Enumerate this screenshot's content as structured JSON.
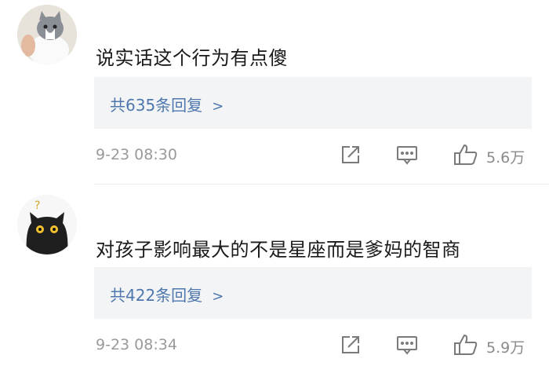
{
  "comments": [
    {
      "avatar_icon": "cat-avatar-icon",
      "text": "说实话这个行为有点傻",
      "reply_label": "共635条回复",
      "timestamp": "9-23 08:30",
      "likes": "5.6万"
    },
    {
      "avatar_icon": "black-cat-avatar-icon",
      "text": "对孩子影响最大的不是星座而是爹妈的智商",
      "reply_label": "共422条回复",
      "timestamp": "9-23 08:34",
      "likes": "5.9万"
    }
  ],
  "colors": {
    "reply_link": "#4e77ad",
    "reply_bg": "#f3f4f6",
    "meta_text": "#9a9a9a",
    "icon_stroke": "#7a7a7a"
  },
  "icons": {
    "share": "share-icon",
    "reply": "comment-icon",
    "like": "thumbs-up-icon",
    "chevron": "chevron-right-icon"
  }
}
